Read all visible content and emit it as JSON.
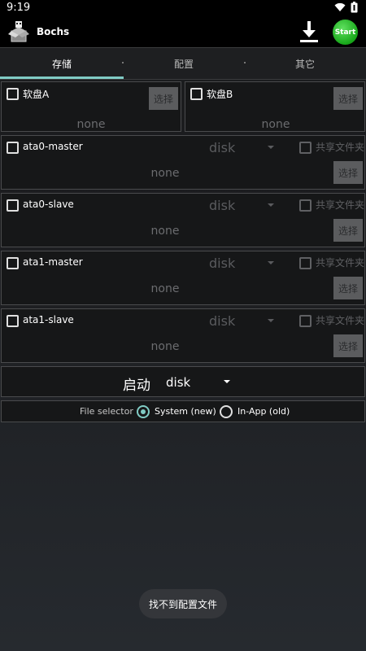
{
  "status": {
    "time": "9:19"
  },
  "app": {
    "title": "Bochs",
    "start_label": "Start"
  },
  "tabs": [
    {
      "label": "存储",
      "active": true
    },
    {
      "label": "配置",
      "active": false
    },
    {
      "label": "其它",
      "active": false
    }
  ],
  "floppies": [
    {
      "label": "软盘A",
      "value": "none",
      "button": "选择",
      "checked": false
    },
    {
      "label": "软盘B",
      "value": "none",
      "button": "选择",
      "checked": false
    }
  ],
  "drives": [
    {
      "label": "ata0-master",
      "type": "disk",
      "share_label": "共享文件夹",
      "value": "none",
      "button": "选择",
      "checked": false
    },
    {
      "label": "ata0-slave",
      "type": "disk",
      "share_label": "共享文件夹",
      "value": "none",
      "button": "选择",
      "checked": false
    },
    {
      "label": "ata1-master",
      "type": "disk",
      "share_label": "共享文件夹",
      "value": "none",
      "button": "选择",
      "checked": false
    },
    {
      "label": "ata1-slave",
      "type": "disk",
      "share_label": "共享文件夹",
      "value": "none",
      "button": "选择",
      "checked": false
    }
  ],
  "boot": {
    "label": "启动",
    "value": "disk"
  },
  "file_selector": {
    "label": "File selector",
    "options": [
      {
        "label": "System (new)",
        "selected": true
      },
      {
        "label": "In-App (old)",
        "selected": false
      }
    ]
  },
  "toast": {
    "text": "找不到配置文件"
  },
  "colors": {
    "accent": "#80cbc4",
    "start_green": "#18a81a",
    "background": "#1a1b1d"
  }
}
